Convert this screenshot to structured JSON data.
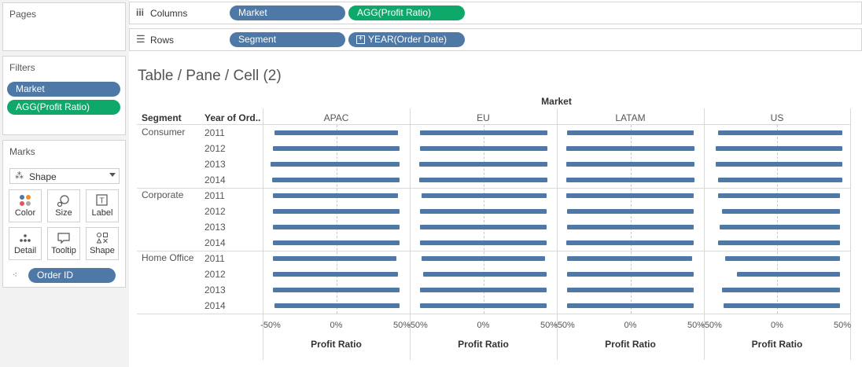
{
  "sidebar": {
    "pages": {
      "title": "Pages"
    },
    "filters": {
      "title": "Filters",
      "items": [
        "Market",
        "AGG(Profit Ratio)"
      ]
    },
    "marks": {
      "title": "Marks",
      "type": "Shape",
      "buttons": [
        "Color",
        "Size",
        "Label",
        "Detail",
        "Tooltip",
        "Shape"
      ],
      "detail_pill": "Order ID"
    }
  },
  "shelves": {
    "columns": {
      "label": "Columns",
      "pills": [
        "Market",
        "AGG(Profit Ratio)"
      ]
    },
    "rows": {
      "label": "Rows",
      "pills": [
        "Segment",
        "YEAR(Order Date)"
      ]
    }
  },
  "view": {
    "title": "Table / Pane / Cell (2)"
  },
  "chart_data": {
    "type": "scatter",
    "mark": "shape",
    "title": "Table / Pane / Cell (2)",
    "column_header": "Market",
    "row_headers": [
      "Segment",
      "Year of Ord.."
    ],
    "markets": [
      "APAC",
      "EU",
      "LATAM",
      "US"
    ],
    "segments": [
      "Consumer",
      "Corporate",
      "Home Office"
    ],
    "years": [
      "2011",
      "2012",
      "2013",
      "2014"
    ],
    "xlabel": "Profit Ratio",
    "x_ticks": [
      "-50%",
      "0%",
      "50%"
    ],
    "xlim": [
      -0.5,
      0.5
    ],
    "color": "#4e79a7",
    "cells": [
      [
        [
          [
            -0.47,
            0.47
          ],
          [
            -0.48,
            0.48
          ],
          [
            -0.5,
            0.48
          ],
          [
            -0.49,
            0.48
          ]
        ],
        [
          [
            -0.48,
            0.49
          ],
          [
            -0.48,
            0.49
          ],
          [
            -0.49,
            0.49
          ],
          [
            -0.49,
            0.49
          ]
        ],
        [
          [
            -0.48,
            0.48
          ],
          [
            -0.49,
            0.49
          ],
          [
            -0.49,
            0.49
          ],
          [
            -0.49,
            0.49
          ]
        ],
        [
          [
            -0.45,
            0.5
          ],
          [
            -0.47,
            0.5
          ],
          [
            -0.47,
            0.5
          ],
          [
            -0.45,
            0.5
          ]
        ]
      ],
      [
        [
          [
            -0.48,
            0.47
          ],
          [
            -0.48,
            0.48
          ],
          [
            -0.48,
            0.48
          ],
          [
            -0.48,
            0.48
          ]
        ],
        [
          [
            -0.47,
            0.48
          ],
          [
            -0.48,
            0.48
          ],
          [
            -0.48,
            0.48
          ],
          [
            -0.48,
            0.48
          ]
        ],
        [
          [
            -0.49,
            0.48
          ],
          [
            -0.48,
            0.48
          ],
          [
            -0.48,
            0.48
          ],
          [
            -0.49,
            0.48
          ]
        ],
        [
          [
            -0.45,
            0.48
          ],
          [
            -0.42,
            0.48
          ],
          [
            -0.44,
            0.48
          ],
          [
            -0.45,
            0.48
          ]
        ]
      ],
      [
        [
          [
            -0.48,
            0.46
          ],
          [
            -0.48,
            0.47
          ],
          [
            -0.48,
            0.48
          ],
          [
            -0.47,
            0.48
          ]
        ],
        [
          [
            -0.47,
            0.47
          ],
          [
            -0.46,
            0.48
          ],
          [
            -0.48,
            0.48
          ],
          [
            -0.48,
            0.48
          ]
        ],
        [
          [
            -0.48,
            0.47
          ],
          [
            -0.48,
            0.48
          ],
          [
            -0.48,
            0.48
          ],
          [
            -0.48,
            0.48
          ]
        ],
        [
          [
            -0.4,
            0.48
          ],
          [
            -0.31,
            0.48
          ],
          [
            -0.42,
            0.48
          ],
          [
            -0.41,
            0.48
          ]
        ]
      ]
    ]
  }
}
